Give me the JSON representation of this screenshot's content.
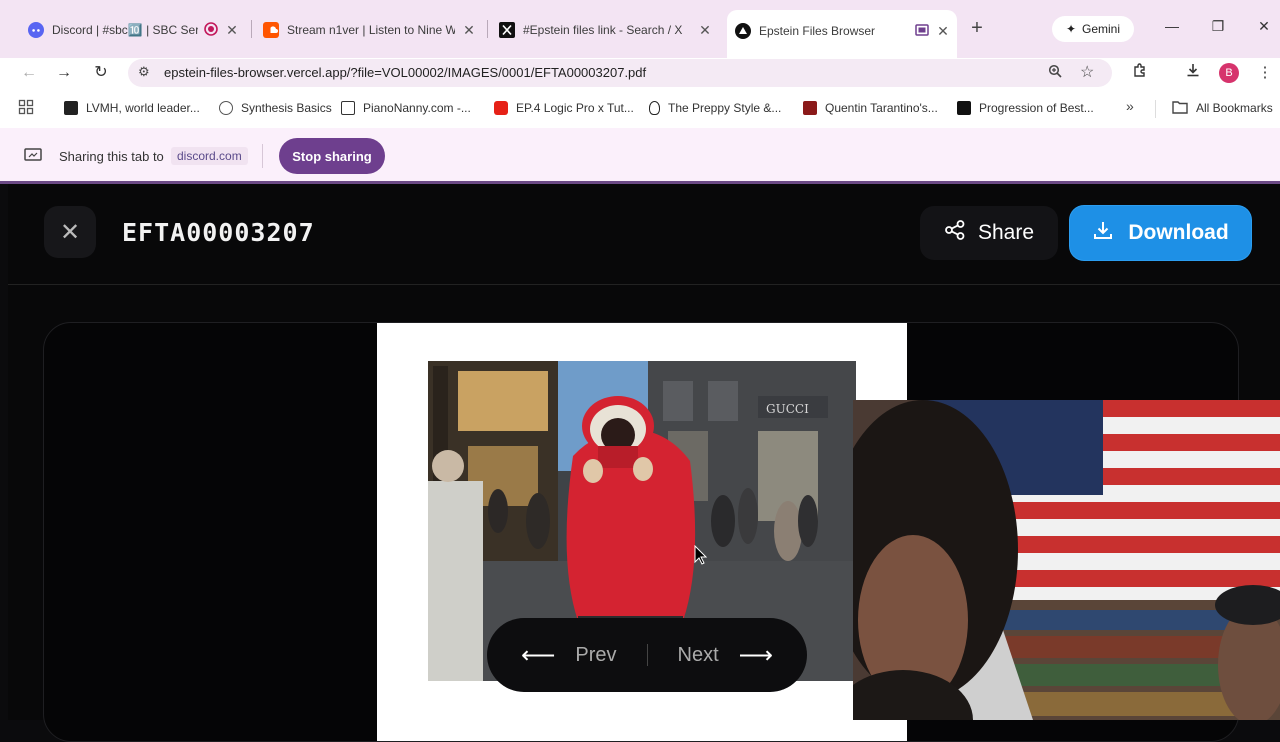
{
  "browser": {
    "tabs": [
      {
        "title": "Discord | #sbc🔟 | SBC Ser",
        "icon": "discord-icon",
        "recording": true
      },
      {
        "title": "Stream n1ver | Listen to Nine W",
        "icon": "soundcloud-icon"
      },
      {
        "title": "#Epstein files link - Search / X",
        "icon": "x-logo-icon"
      },
      {
        "title": "Epstein Files Browser",
        "icon": "vercel-icon",
        "active": true
      }
    ],
    "gemini_label": "Gemini",
    "url": "epstein-files-browser.vercel.app/?file=VOL00002/IMAGES/0001/EFTA00003207.pdf",
    "profile_initial": "B",
    "bookmarks": [
      "LVMH, world leader...",
      "Synthesis Basics",
      "PianoNanny.com -...",
      "EP.4 Logic Pro x Tut...",
      "The Preppy Style &...",
      "Quentin Tarantino's...",
      "Progression of Best..."
    ],
    "all_bookmarks_label": "All Bookmarks"
  },
  "sharing": {
    "text": "Sharing this tab to",
    "target": "discord.com",
    "stop_label": "Stop sharing"
  },
  "app": {
    "filename": "EFTA00003207",
    "share_label": "Share",
    "download_label": "Download",
    "prev_label": "Prev",
    "next_label": "Next"
  },
  "colors": {
    "accent": "#1e90e6",
    "stop_button": "#6e3f8e",
    "tabstrip": "#f3e4f3"
  }
}
